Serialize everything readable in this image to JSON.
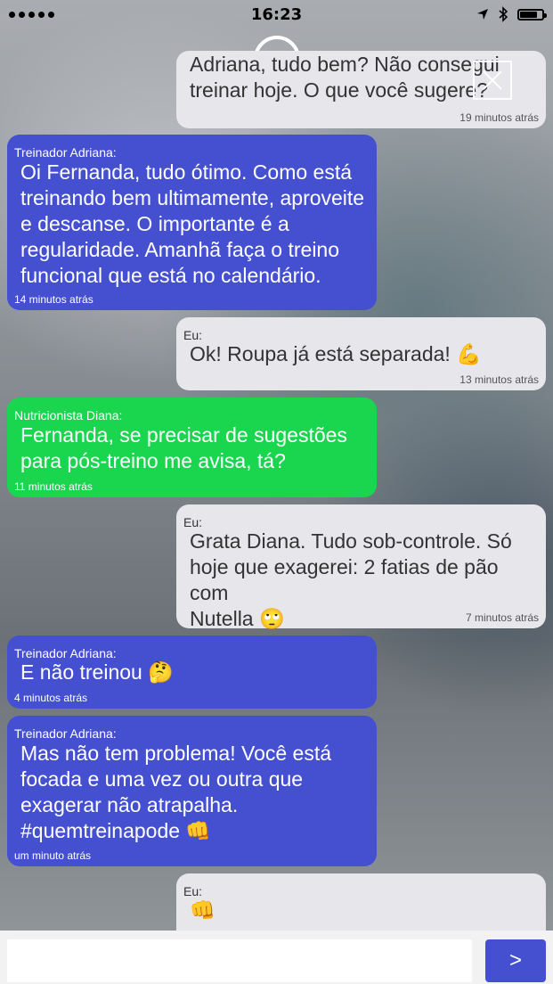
{
  "status_bar": {
    "time": "16:23",
    "battery_level": 0.8
  },
  "messages": [
    {
      "sender": "",
      "text": "Adriana, tudo bem? Não consegui\ntreinar hoje. O que você sugere?",
      "time": "19 minutos atrás"
    },
    {
      "sender": "Treinador Adriana:",
      "text": "Oi Fernanda, tudo ótimo. Como está\ntreinando bem ultimamente, aproveite\ne descanse. O importante é a\nregularidade. Amanhã faça o treino\nfuncional que está no calendário.",
      "time": "14 minutos atrás"
    },
    {
      "sender": "Eu:",
      "text": "Ok! Roupa já está separada! 💪",
      "time": "13 minutos atrás"
    },
    {
      "sender": "Nutricionista Diana:",
      "text": "Fernanda, se precisar de sugestões\npara pós-treino me avisa, tá?",
      "time": "11 minutos atrás"
    },
    {
      "sender": "Eu:",
      "text": "Grata Diana. Tudo sob-controle. Só\nhoje que exagerei: 2 fatias de pão com\nNutella 🙄",
      "time": "7 minutos atrás"
    },
    {
      "sender": "Treinador Adriana:",
      "text": "E não treinou 🤔",
      "time": "4 minutos atrás"
    },
    {
      "sender": "Treinador Adriana:",
      "text": "Mas não tem problema! Você está\nfocada e uma vez ou outra que\nexagerar não atrapalha.\n#quemtreinapode 👊",
      "time": "um minuto atrás"
    },
    {
      "sender": "Eu:",
      "text": "👊",
      "time": ""
    }
  ],
  "composer": {
    "placeholder": "",
    "send_label": ">"
  },
  "colors": {
    "coach": "#4550d1",
    "nutritionist": "#19d64e",
    "me": "#e6e6eb"
  }
}
